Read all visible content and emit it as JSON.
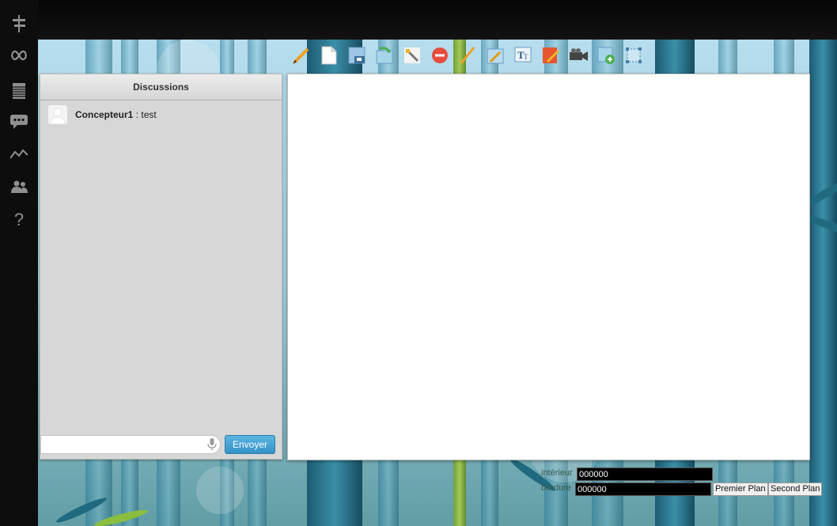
{
  "sidebar": {
    "icons": [
      "signpost-icon",
      "infinity-icon",
      "notes-icon",
      "chat-icon",
      "chart-icon",
      "users-icon",
      "help-icon"
    ],
    "help_label": "?"
  },
  "toolbar": {
    "tools": [
      "pencil-icon",
      "new-page-icon",
      "save-icon",
      "import-image-icon",
      "magic-wand-icon",
      "delete-icon",
      "line-icon",
      "rectangle-edit-icon",
      "text-tool-icon",
      "fill-icon",
      "video-camera-icon",
      "add-image-icon",
      "select-resize-icon"
    ]
  },
  "chat": {
    "title": "Discussions",
    "messages": [
      {
        "author": "Concepteur1",
        "separator": " : ",
        "text": "test"
      }
    ],
    "input_value": "",
    "send_label": "Envoyer"
  },
  "colors": {
    "interior_label": "intérieur",
    "interior_value": "000000",
    "border_label": "bordure",
    "border_value": "000000",
    "foreground_label": "Premier Plan",
    "background_label": "Second Plan"
  },
  "theme": {
    "sidebar_bg": "#0d0d0d",
    "accent_button": "#3492c6",
    "panel_bg": "#d7d7d7",
    "canvas_bg": "#ffffff"
  }
}
